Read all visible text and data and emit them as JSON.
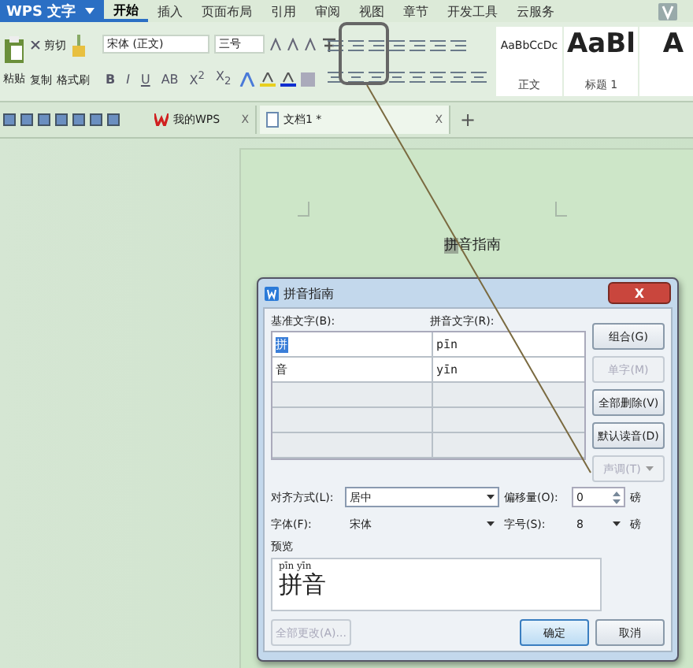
{
  "app_menu": {
    "label": "WPS 文字"
  },
  "menu_tabs": [
    {
      "label": "开始",
      "selected": true
    },
    {
      "label": "插入",
      "selected": false
    },
    {
      "label": "页面布局",
      "selected": false
    },
    {
      "label": "引用",
      "selected": false
    },
    {
      "label": "审阅",
      "selected": false
    },
    {
      "label": "视图",
      "selected": false
    },
    {
      "label": "章节",
      "selected": false
    },
    {
      "label": "开发工具",
      "selected": false
    },
    {
      "label": "云服务",
      "selected": false
    }
  ],
  "clipboard": {
    "paste": "粘贴",
    "cut": "剪切",
    "copy": "复制",
    "format_painter": "格式刷"
  },
  "font": {
    "family": "宋体 (正文)",
    "size": "三号"
  },
  "format_buttons": [
    {
      "label": "B",
      "kind": "bold"
    },
    {
      "label": "I",
      "kind": "italic"
    },
    {
      "label": "U",
      "kind": "underline"
    },
    {
      "label": "AB",
      "kind": "plain"
    },
    {
      "label": "X$^{2}$",
      "kind": "plain"
    },
    {
      "label": "X$_{2}$",
      "kind": "plain"
    }
  ],
  "styles": [
    {
      "sample": "AaBbCcDc",
      "name": "正文",
      "kind": "normal"
    },
    {
      "sample": "AaBl",
      "name": "标题 1",
      "kind": "heading"
    },
    {
      "sample": "A",
      "kind": "heading"
    }
  ],
  "doc_tabs": [
    {
      "label": "我的WPS",
      "kind": "home",
      "selected": false,
      "close": "X"
    },
    {
      "label": "文档1 *",
      "kind": "doc",
      "selected": true,
      "close": "X"
    }
  ],
  "new_tab": "+",
  "document": {
    "selected_text": "拼",
    "text": "音指南"
  },
  "dialog": {
    "title": "拼音指南",
    "close": "X",
    "base_label": "基准文字(B):",
    "ruby_label": "拼音文字(R):",
    "rows": [
      {
        "base": "拼",
        "ruby": "pīn",
        "selected": true
      },
      {
        "base": "音",
        "ruby": "yīn",
        "selected": false
      }
    ],
    "side_buttons": [
      {
        "label": "组合(G)",
        "disabled": false,
        "kind": "plain"
      },
      {
        "label": "单字(M)",
        "disabled": true,
        "kind": "plain"
      },
      {
        "label": "全部删除(V)",
        "disabled": false,
        "kind": "plain"
      },
      {
        "label": "默认读音(D)",
        "disabled": false,
        "kind": "plain"
      },
      {
        "label": "声调(T)",
        "disabled": true,
        "kind": "dropdown"
      }
    ],
    "alignment": {
      "label": "对齐方式(L):",
      "value": "居中"
    },
    "offset": {
      "label": "偏移量(O):",
      "value": "0",
      "unit": "磅"
    },
    "font": {
      "label": "字体(F):",
      "value": "宋体"
    },
    "size": {
      "label": "字号(S):",
      "value": "8",
      "unit": "磅"
    },
    "preview": {
      "label": "预览",
      "ruby": "pīn yīn",
      "text": "拼音"
    },
    "footer_buttons": [
      {
        "label": "全部更改(A)...",
        "disabled": true,
        "kind": "plain"
      },
      {
        "label": "确定",
        "disabled": false,
        "kind": "default"
      },
      {
        "label": "取消",
        "disabled": false,
        "kind": "plain"
      }
    ]
  }
}
